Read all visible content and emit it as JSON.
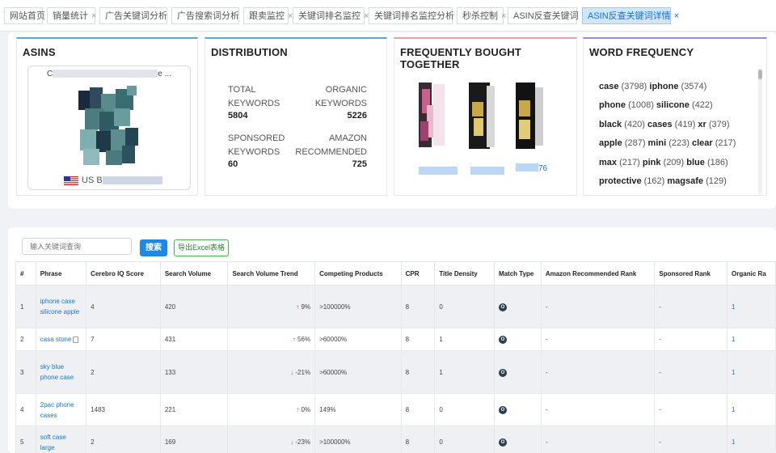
{
  "tabs": [
    {
      "label": "网站首页",
      "closable": false
    },
    {
      "label": "销量统计",
      "closable": true
    },
    {
      "label": "广告关键词分析",
      "closable": true
    },
    {
      "label": "广告搜索词分析",
      "closable": true
    },
    {
      "label": "跟卖监控",
      "closable": true
    },
    {
      "label": "关键词排名监控",
      "closable": true
    },
    {
      "label": "关键词排名监控分析",
      "closable": true
    },
    {
      "label": "秒杀控制",
      "closable": true
    },
    {
      "label": "ASIN反查关键词",
      "closable": true
    },
    {
      "label": "ASIN反查关键词详情",
      "closable": true,
      "active": true
    }
  ],
  "close_glyph": "×",
  "asins": {
    "title": "ASINS",
    "product_title_start": "C",
    "product_title_end": "e ...",
    "marketplace": "US",
    "asin_prefix": "B"
  },
  "distribution": {
    "title": "DISTRIBUTION",
    "total_label": "TOTAL KEYWORDS",
    "total_value": "5804",
    "organic_label": "ORGANIC KEYWORDS",
    "organic_value": "5226",
    "sponsored_label": "SPONSORED KEYWORDS",
    "sponsored_value": "60",
    "amazon_label": "AMAZON RECOMMENDED",
    "amazon_value": "725"
  },
  "fbt": {
    "title": "FREQUENTLY BOUGHT TOGETHER",
    "link_tail": "76"
  },
  "word_frequency": {
    "title": "WORD FREQUENCY",
    "rows": [
      [
        {
          "word": "case",
          "count": "(3798)"
        },
        {
          "word": "iphone",
          "count": "(3574)"
        }
      ],
      [
        {
          "word": "phone",
          "count": "(1008)"
        },
        {
          "word": "silicone",
          "count": "(422)"
        }
      ],
      [
        {
          "word": "black",
          "count": "(420)"
        },
        {
          "word": "cases",
          "count": "(419)"
        },
        {
          "word": "xr",
          "count": "(379)"
        }
      ],
      [
        {
          "word": "apple",
          "count": "(287)"
        },
        {
          "word": "mini",
          "count": "(223)"
        },
        {
          "word": "clear",
          "count": "(217)"
        }
      ],
      [
        {
          "word": "max",
          "count": "(217)"
        },
        {
          "word": "pink",
          "count": "(209)"
        },
        {
          "word": "blue",
          "count": "(186)"
        }
      ],
      [
        {
          "word": "protective",
          "count": "(162)"
        },
        {
          "word": "magsafe",
          "count": "(129)"
        }
      ]
    ]
  },
  "search": {
    "placeholder": "输入关键词查询",
    "search_label": "搜索",
    "export_label": "导出Excel表格"
  },
  "table": {
    "headers": [
      "#",
      "Phrase",
      "Cerebro IQ Score",
      "Search Volume",
      "Search Volume Trend",
      "Competing Products",
      "CPR",
      "Title Density",
      "Match Type",
      "Amazon Recommended Rank",
      "Sponsored Rank",
      "Organic Ra"
    ],
    "rows": [
      {
        "idx": "1",
        "phrase": "iphone case silicone apple",
        "iq": "4",
        "sv": "420",
        "trend_dir": "up",
        "trend": "9%",
        "comp": ">100000%",
        "cpr": "8",
        "density": "0",
        "match": "O",
        "amazon": "-",
        "sponsored": "-",
        "organic": "1"
      },
      {
        "idx": "2",
        "phrase": "casa stone",
        "copy": true,
        "iq": "7",
        "sv": "431",
        "trend_dir": "up",
        "trend": "56%",
        "comp": ">60000%",
        "cpr": "8",
        "density": "1",
        "match": "O",
        "amazon": "-",
        "sponsored": "-",
        "organic": "1"
      },
      {
        "idx": "3",
        "phrase": "sky blue phone case",
        "iq": "2",
        "sv": "133",
        "trend_dir": "down",
        "trend": "-21%",
        "comp": ">60000%",
        "cpr": "8",
        "density": "1",
        "match": "O",
        "amazon": "-",
        "sponsored": "-",
        "organic": "1"
      },
      {
        "idx": "4",
        "phrase": "2pac phone cases",
        "iq": "1483",
        "sv": "221",
        "trend_dir": "up",
        "trend": "0%",
        "comp": "149%",
        "cpr": "8",
        "density": "0",
        "match": "O",
        "amazon": "-",
        "sponsored": "-",
        "organic": "1"
      },
      {
        "idx": "5",
        "phrase": "soft case large",
        "iq": "2",
        "sv": "169",
        "trend_dir": "down",
        "trend": "-23%",
        "comp": ">100000%",
        "cpr": "8",
        "density": "0",
        "match": "O",
        "amazon": "-",
        "sponsored": "-",
        "organic": "1"
      }
    ]
  },
  "colors": {
    "accent": "#1e88e5",
    "up": "#e53935",
    "down": "#43a047",
    "export": "#4caf50"
  }
}
